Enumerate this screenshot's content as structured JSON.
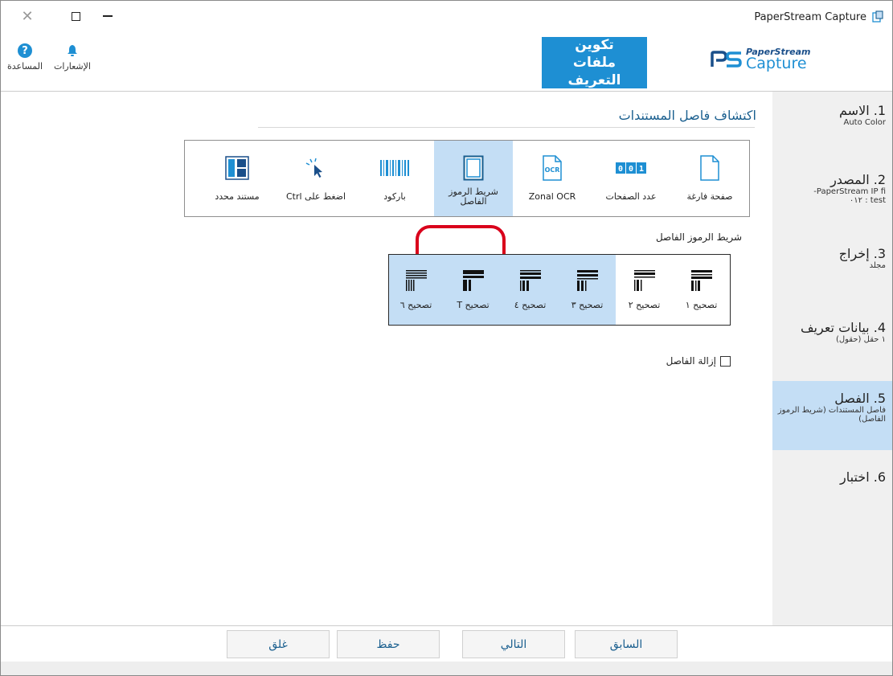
{
  "window": {
    "title": "PaperStream Capture"
  },
  "header": {
    "help_label": "المساعدة",
    "notifications_label": "الإشعارات",
    "config_button": "تكوين ملفات التعريف",
    "logo_line1": "PaperStream",
    "logo_line2": "Capture"
  },
  "main": {
    "section_title": "اكتشاف فاصل المستندات",
    "methods": [
      {
        "label": "صفحة فارغة",
        "icon": "blank-page-icon"
      },
      {
        "label": "عدد الصفحات",
        "icon": "page-count-icon"
      },
      {
        "label": "Zonal OCR",
        "icon": "ocr-icon"
      },
      {
        "label": "شريط الرموز الفاصل",
        "icon": "patch-code-icon",
        "selected": true
      },
      {
        "label": "باركود",
        "icon": "barcode-icon"
      },
      {
        "label": "اضغط على Ctrl",
        "icon": "cursor-click-icon"
      },
      {
        "label": "مستند محدد",
        "icon": "specific-doc-icon"
      }
    ],
    "ocr_icon_text": "OCR",
    "page_count_icon_text": "00",
    "patch_section_label": "شريط الرموز الفاصل",
    "patch_codes": [
      {
        "label": "تصحيح ١",
        "selected": false
      },
      {
        "label": "تصحيح ٢",
        "selected": false
      },
      {
        "label": "تصحيح ٣",
        "selected": true
      },
      {
        "label": "تصحيح ٤",
        "selected": true
      },
      {
        "label": "تصحيح T",
        "selected": true
      },
      {
        "label": "تصحيح ٦",
        "selected": true
      }
    ],
    "remove_separator_label": "إزالة الفاصل"
  },
  "sidebar": {
    "steps": [
      {
        "title": "1. الاسم",
        "subtitle": "Auto Color"
      },
      {
        "title": "2. المصدر",
        "subtitle": "PaperStream IP fi-",
        "subtitle2": "test : ٠١٢"
      },
      {
        "title": "3. إخراج",
        "subtitle": "مجلد"
      },
      {
        "title": "4. بيانات تعريف",
        "subtitle": "١ حقل (حقول)"
      },
      {
        "title": "5. الفصل",
        "subtitle": "فاصل المستندات (شريط الرموز الفاصل)",
        "active": true
      },
      {
        "title": "6. اختبار",
        "subtitle": ""
      }
    ]
  },
  "footer": {
    "previous": "السابق",
    "next": "التالي",
    "save": "حفظ",
    "close": "غلق"
  },
  "colors": {
    "accent": "#1e8fd3",
    "selection": "#c4def5",
    "highlight_ring": "#d9001b"
  }
}
